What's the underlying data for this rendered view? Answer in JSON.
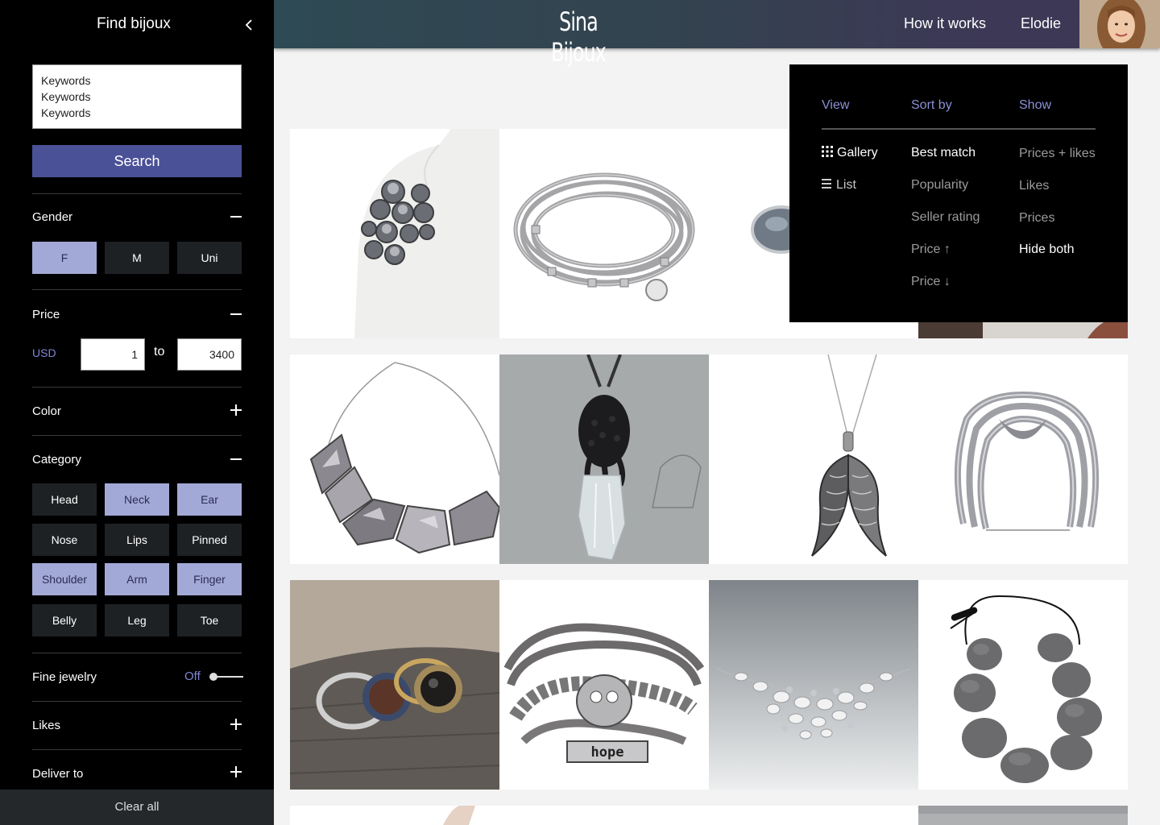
{
  "sidebar": {
    "title": "Find bijoux",
    "keywords": [
      "Keywords",
      "Keywords",
      "Keywords"
    ],
    "search_label": "Search",
    "gender": {
      "label": "Gender",
      "options": [
        {
          "label": "F",
          "selected": true
        },
        {
          "label": "M",
          "selected": false
        },
        {
          "label": "Uni",
          "selected": false
        }
      ]
    },
    "price": {
      "label": "Price",
      "currency": "USD",
      "min": "1",
      "to_label": "to",
      "max": "3400"
    },
    "color": {
      "label": "Color"
    },
    "category": {
      "label": "Category",
      "options": [
        {
          "label": "Head",
          "selected": false
        },
        {
          "label": "Neck",
          "selected": true
        },
        {
          "label": "Ear",
          "selected": true
        },
        {
          "label": "Nose",
          "selected": false
        },
        {
          "label": "Lips",
          "selected": false
        },
        {
          "label": "Pinned",
          "selected": false
        },
        {
          "label": "Shoulder",
          "selected": true
        },
        {
          "label": "Arm",
          "selected": true
        },
        {
          "label": "Finger",
          "selected": true
        },
        {
          "label": "Belly",
          "selected": false
        },
        {
          "label": "Leg",
          "selected": false
        },
        {
          "label": "Toe",
          "selected": false
        }
      ]
    },
    "fine_jewelry": {
      "label": "Fine jewelry",
      "state": "Off"
    },
    "likes": {
      "label": "Likes"
    },
    "deliver_to": {
      "label": "Deliver to"
    },
    "clear_all": "Clear all"
  },
  "header": {
    "brand": "Sina Bijoux",
    "nav": {
      "how_it_works": "How it works",
      "user_name": "Elodie"
    }
  },
  "dropdown": {
    "headers": {
      "view": "View",
      "sort_by": "Sort by",
      "show": "Show"
    },
    "view_options": [
      {
        "label": "Gallery",
        "icon": "grid-icon",
        "selected": true
      },
      {
        "label": "List",
        "icon": "list-icon",
        "selected": false
      }
    ],
    "sort_options": [
      {
        "label": "Best match",
        "selected": true
      },
      {
        "label": "Popularity",
        "selected": false
      },
      {
        "label": "Seller rating",
        "selected": false
      },
      {
        "label": "Price ↑",
        "selected": false
      },
      {
        "label": "Price ↓",
        "selected": false
      }
    ],
    "show_options": [
      {
        "label": "Prices + likes",
        "selected": false
      },
      {
        "label": "Likes",
        "selected": false
      },
      {
        "label": "Prices",
        "selected": false
      },
      {
        "label": "Hide both",
        "selected": true
      }
    ]
  },
  "products": [
    "shoulder-brooch",
    "grey-cord-bracelet",
    "stone-ring",
    "portrait-model",
    "silver-collar-necklace",
    "tentacle-crystal-pendant",
    "angel-wing-pendant",
    "grey-knot-bracelet",
    "gem-rings",
    "owl-hope-bracelet",
    "pearl-bib-necklace",
    "grey-pebble-necklace",
    "partial-item-1",
    "partial-item-2",
    "partial-item-3",
    "partial-item-4"
  ],
  "colors": {
    "accent": "#4b5196",
    "selected_pill": "#a3a9d6",
    "label_accent": "#8a90d4"
  }
}
